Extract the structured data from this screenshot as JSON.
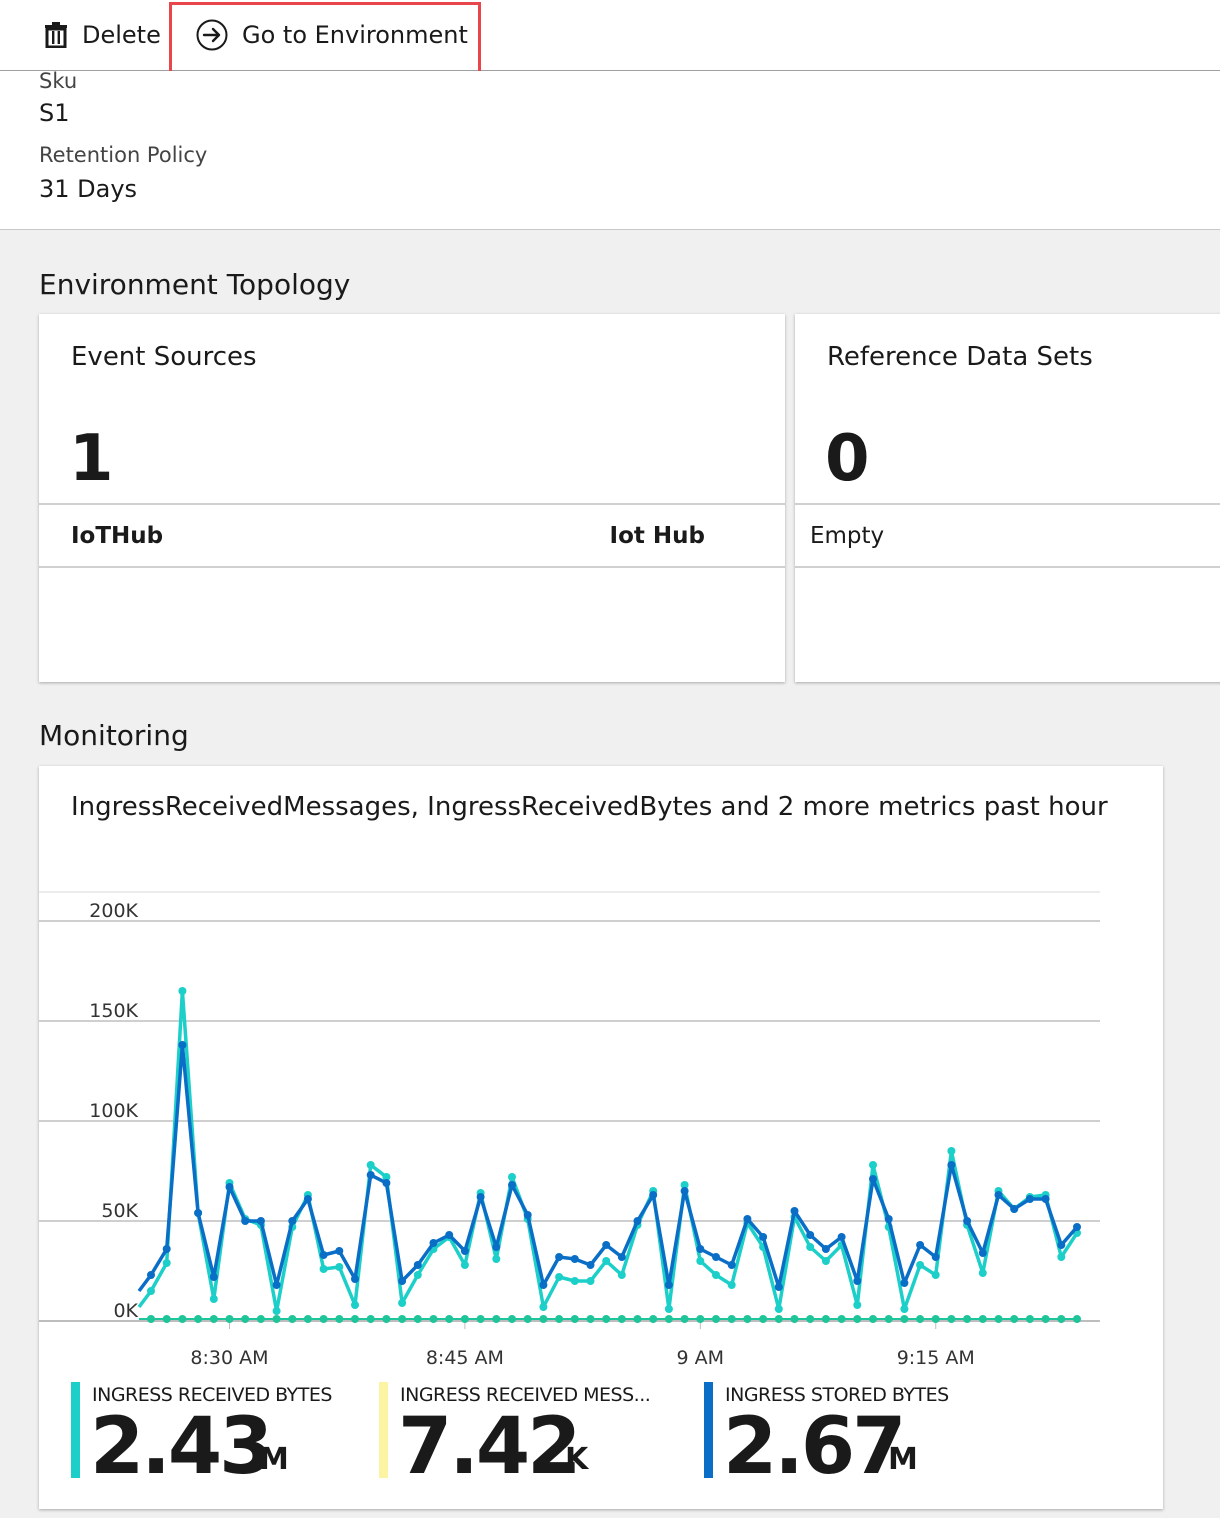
{
  "toolbar": {
    "delete_label": "Delete",
    "goto_label": "Go to Environment"
  },
  "essentials": {
    "sku_label": "Sku",
    "sku_value": "S1",
    "retention_label": "Retention Policy",
    "retention_value": "31 Days"
  },
  "topology": {
    "title": "Environment Topology",
    "event_sources": {
      "title": "Event Sources",
      "count": "1",
      "row_name": "IoTHub",
      "row_type": "Iot Hub"
    },
    "reference_data": {
      "title": "Reference Data Sets",
      "count": "0",
      "row_text": "Empty"
    }
  },
  "monitoring": {
    "title": "Monitoring",
    "tile_title": "IngressReceivedMessages, IngressReceivedBytes and 2 more metrics past hour",
    "legend": [
      {
        "label": "INGRESS RECEIVED BYTES",
        "value": "2.43",
        "unit": "M",
        "color": "#1ccfc9"
      },
      {
        "label": "INGRESS RECEIVED MESS...",
        "value": "7.42",
        "unit": "K",
        "color": "#fcf4a2"
      },
      {
        "label": "INGRESS STORED BYTES",
        "value": "2.67",
        "unit": "M",
        "color": "#0a6ec6"
      }
    ]
  },
  "chart_data": {
    "type": "line",
    "ylim": [
      0,
      200000
    ],
    "ytick_labels": [
      "0K",
      "50K",
      "100K",
      "150K",
      "200K"
    ],
    "xtick_labels": [
      "8:30 AM",
      "8:45 AM",
      "9 AM",
      "9:15 AM"
    ],
    "grid": true,
    "series": [
      {
        "name": "INGRESS RECEIVED BYTES",
        "color": "#1ccfc9",
        "values": [
          15000,
          29000,
          165000,
          54000,
          11000,
          69000,
          51000,
          48000,
          5000,
          47000,
          63000,
          26000,
          27000,
          8000,
          78000,
          72000,
          9000,
          23000,
          36000,
          42000,
          28000,
          64000,
          31000,
          72000,
          51000,
          7000,
          22000,
          20000,
          20000,
          30000,
          23000,
          48000,
          65000,
          6000,
          68000,
          30000,
          23000,
          18000,
          49000,
          37000,
          6000,
          52000,
          37000,
          30000,
          38000,
          8000,
          78000,
          47000,
          6000,
          28000,
          23000,
          85000,
          48000,
          24000,
          65000,
          56000,
          62000,
          63000,
          32000,
          44000
        ]
      },
      {
        "name": "INGRESS RECEIVED MESS...",
        "color": "#fcf4a2",
        "values": [
          1000,
          1000,
          1000,
          1000,
          1000,
          1000,
          1000,
          1000,
          1000,
          1000,
          1000,
          1000,
          1000,
          1000,
          1000,
          1000,
          1000,
          1000,
          1000,
          1000,
          1000,
          1000,
          1000,
          1000,
          1000,
          1000,
          1000,
          1000,
          1000,
          1000,
          1000,
          1000,
          1000,
          1000,
          1000,
          1000,
          1000,
          1000,
          1000,
          1000,
          1000,
          1000,
          1000,
          1000,
          1000,
          1000,
          1000,
          1000,
          1000,
          1000,
          1000,
          1000,
          1000,
          1000,
          1000,
          1000,
          1000,
          1000,
          1000,
          1000
        ]
      },
      {
        "name": "INGRESS STORED BYTES",
        "color": "#0a6ec6",
        "values": [
          23000,
          36000,
          138000,
          54000,
          22000,
          67000,
          50000,
          50000,
          18000,
          50000,
          61000,
          33000,
          35000,
          21000,
          73000,
          69000,
          20000,
          28000,
          39000,
          43000,
          35000,
          62000,
          37000,
          68000,
          53000,
          18000,
          32000,
          31000,
          28000,
          38000,
          32000,
          50000,
          63000,
          18000,
          65000,
          36000,
          32000,
          28000,
          51000,
          42000,
          17000,
          55000,
          43000,
          36000,
          42000,
          20000,
          71000,
          51000,
          19000,
          38000,
          32000,
          78000,
          50000,
          34000,
          63000,
          56000,
          61000,
          61000,
          38000,
          47000
        ]
      }
    ]
  }
}
